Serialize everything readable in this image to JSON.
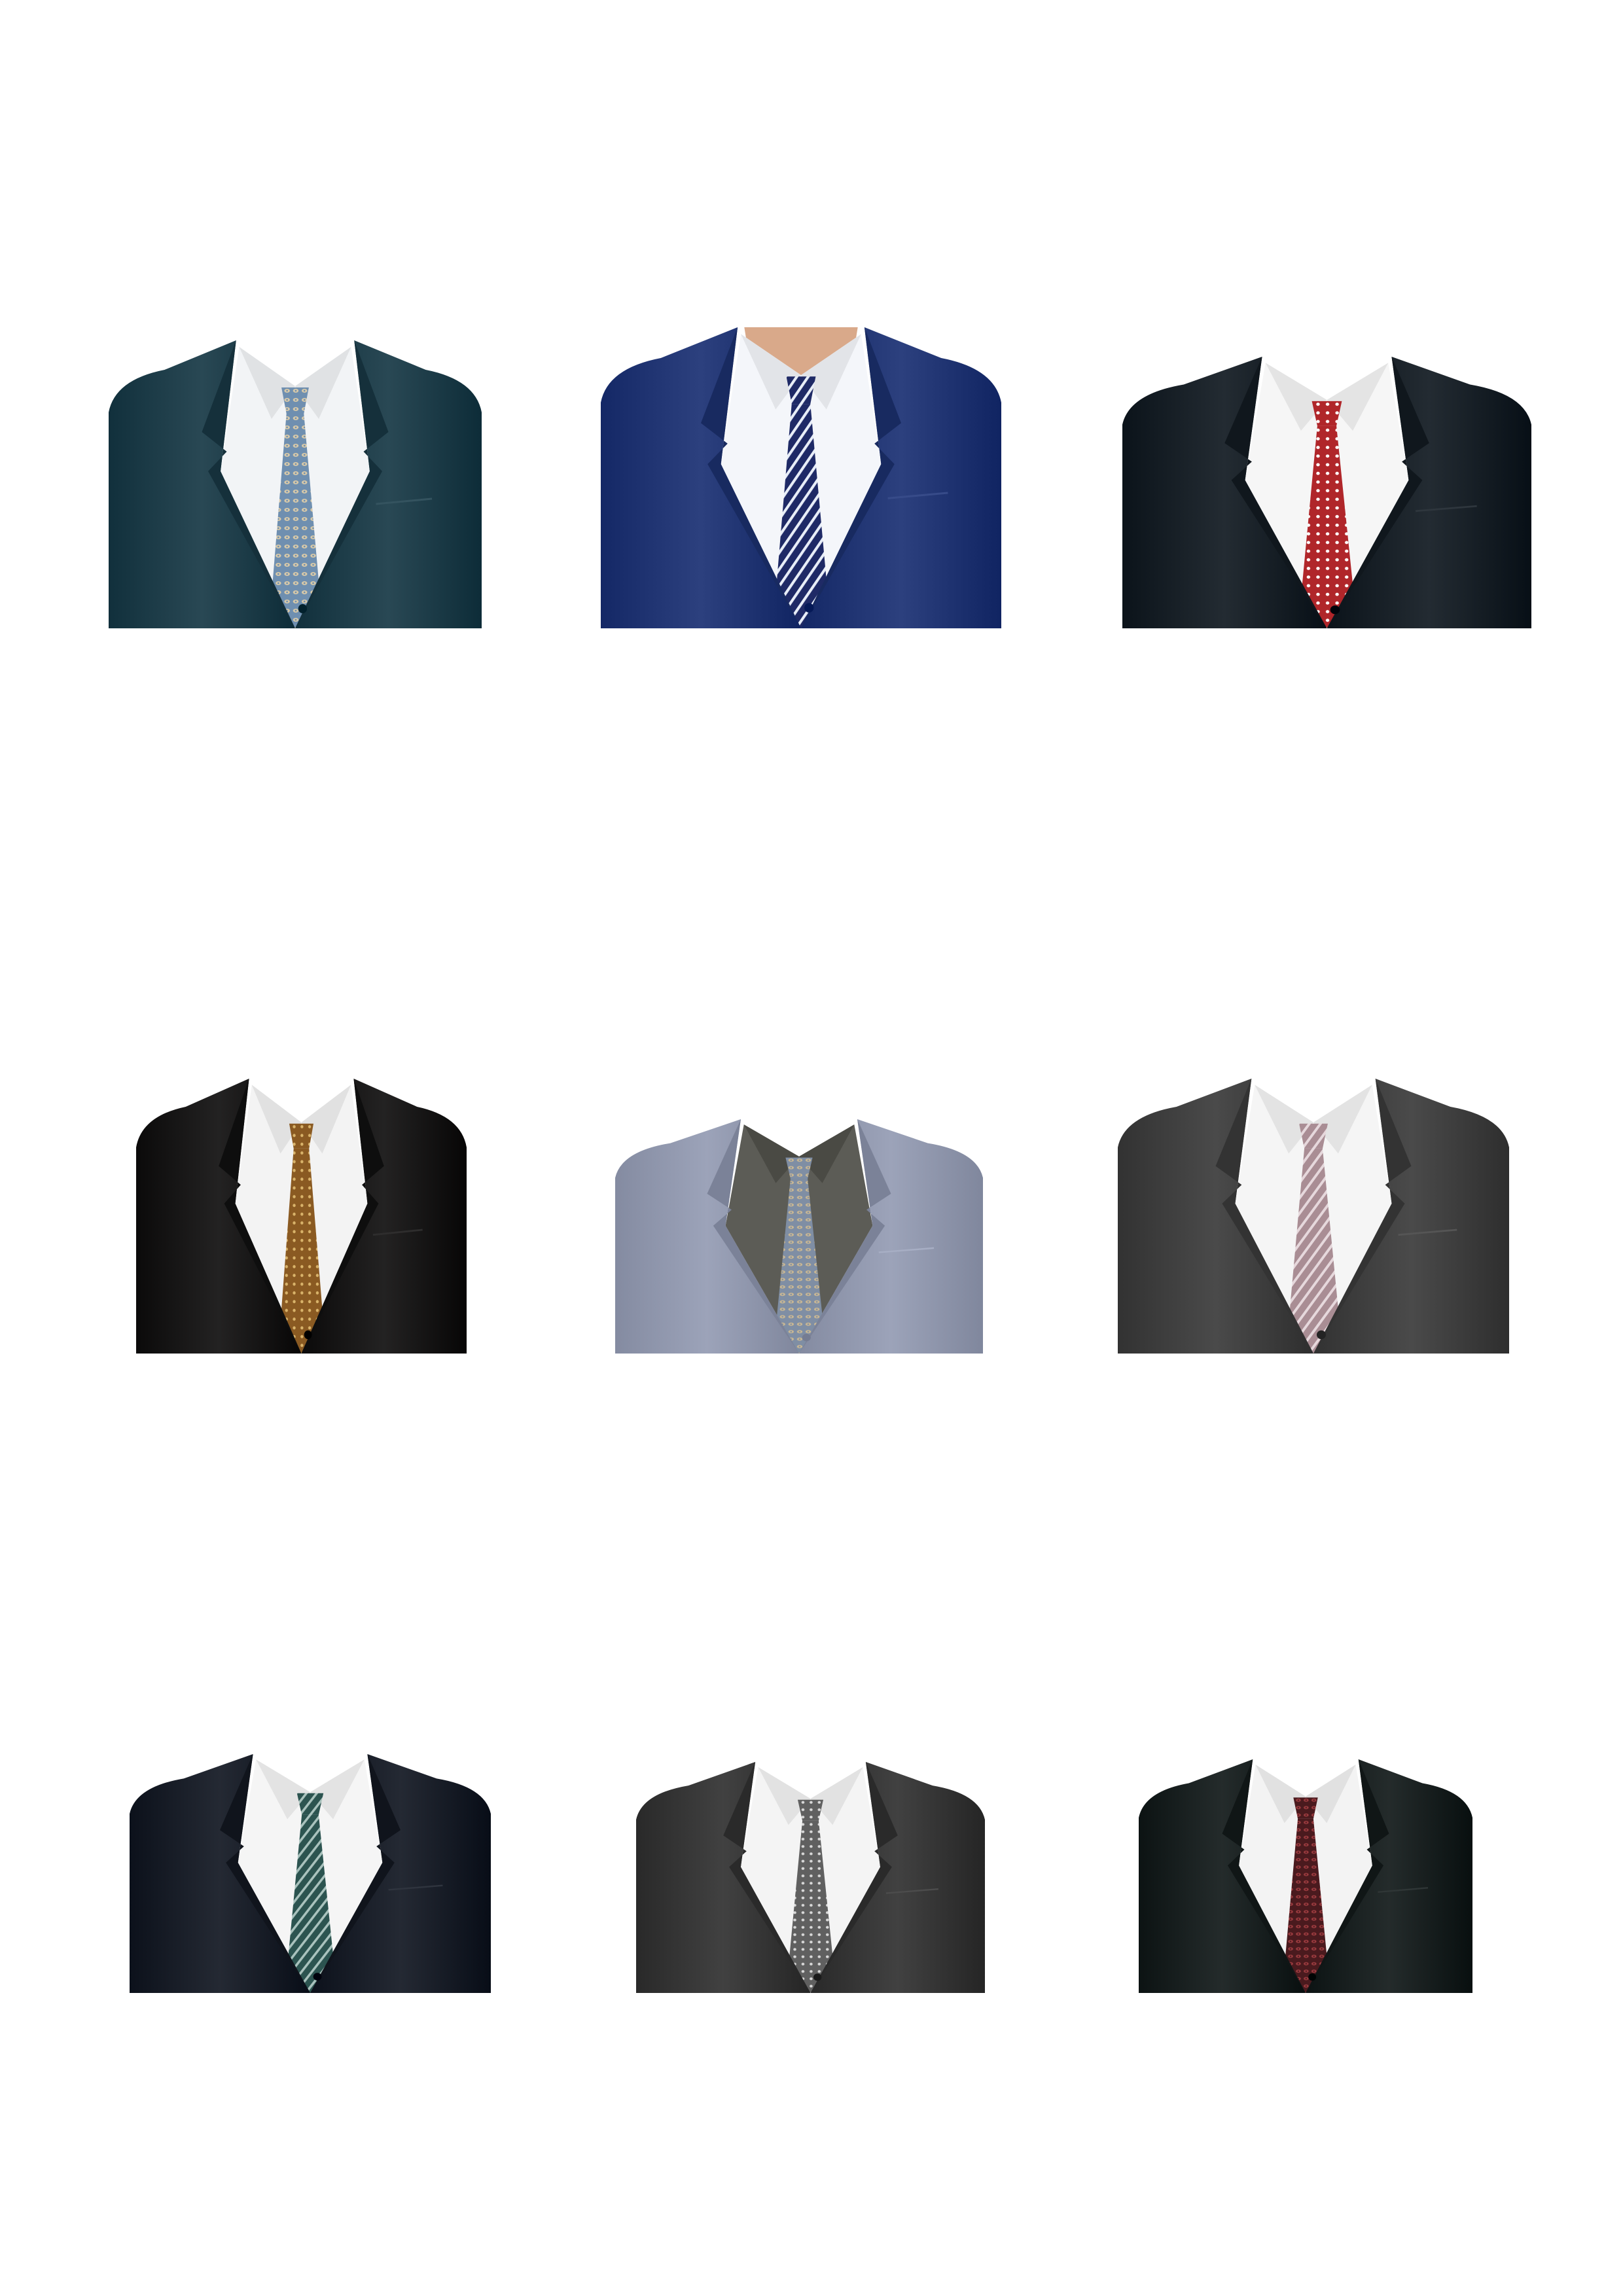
{
  "suits": [
    {
      "label": "suit-1",
      "jacket": "#1b3a46",
      "lapel": "#15303b",
      "shirt": "#f2f4f6",
      "tie": "#6f8fb0",
      "tie_accent": "#d8c9a8",
      "pattern": "paisley",
      "bg": "#ffffff"
    },
    {
      "label": "suit-2",
      "jacket": "#1e3270",
      "lapel": "#182a60",
      "shirt": "#f4f6fa",
      "tie": "#1f2a66",
      "tie_accent": "#e8eef8",
      "pattern": "stripes",
      "bg": "#ffffff",
      "neck": "#d9a98a"
    },
    {
      "label": "suit-3",
      "jacket": "#151d24",
      "lapel": "#10171d",
      "shirt": "#f6f6f6",
      "tie": "#b0262a",
      "tie_accent": "#ffffff",
      "pattern": "dots",
      "bg": "#ffffff"
    },
    {
      "label": "suit-4",
      "jacket": "#151414",
      "lapel": "#0e0e0e",
      "shirt": "#f3f3f3",
      "tie": "#8a5a22",
      "tie_accent": "#d9b36a",
      "pattern": "dots",
      "bg": "#ffffff"
    },
    {
      "label": "suit-5",
      "jacket": "#8e95ab",
      "lapel": "#7b8298",
      "shirt": "#5c5c56",
      "tie": "#7f8ea4",
      "tie_accent": "#c9b793",
      "pattern": "paisley",
      "bg": "#ffffff"
    },
    {
      "label": "suit-6",
      "jacket": "#3c3c3c",
      "lapel": "#333333",
      "shirt": "#f5f5f5",
      "tie": "#a98d94",
      "tie_accent": "#e6d8dc",
      "pattern": "stripes",
      "bg": "#ffffff"
    },
    {
      "label": "suit-7",
      "jacket": "#161b25",
      "lapel": "#10141c",
      "shirt": "#f5f5f5",
      "tie": "#2c5450",
      "tie_accent": "#a9c2bd",
      "pattern": "stripes",
      "bg": "#ffffff"
    },
    {
      "label": "suit-8",
      "jacket": "#333333",
      "lapel": "#2a2a2a",
      "shirt": "#f4f4f4",
      "tie": "#606060",
      "tie_accent": "#d8d8d8",
      "pattern": "dots",
      "bg": "#ffffff"
    },
    {
      "label": "suit-9",
      "jacket": "#161d1d",
      "lapel": "#101616",
      "shirt": "#f3f3f3",
      "tie": "#4a1a1e",
      "tie_accent": "#9a3a3e",
      "pattern": "paisley",
      "bg": "#ffffff"
    }
  ]
}
